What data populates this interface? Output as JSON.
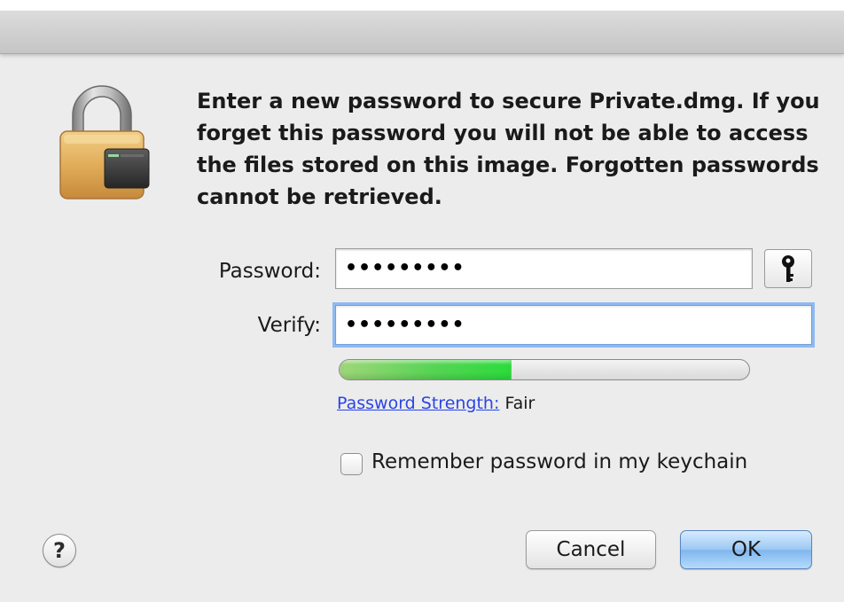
{
  "dialog": {
    "icon": "padlock-icon",
    "message": "Enter a new password to secure Private.dmg.  If you forget this password you will not be able to access the files stored on this image. Forgotten passwords cannot be retrieved."
  },
  "form": {
    "password_label": "Password:",
    "password_value": "•••••••••",
    "verify_label": "Verify:",
    "verify_value": "•••••••••",
    "key_button_icon": "key-icon"
  },
  "strength": {
    "fill_fraction": 0.42,
    "link_label": "Password Strength:",
    "value": "Fair",
    "colors": {
      "fill_start": "#9fd67a",
      "fill_end": "#2bdc3c"
    }
  },
  "keychain": {
    "label": "Remember password in my keychain",
    "checked": false
  },
  "buttons": {
    "help_label": "?",
    "cancel_label": "Cancel",
    "ok_label": "OK"
  },
  "colors": {
    "link": "#2a45e6",
    "focus_ring": "#8fbaf0",
    "default_button": "#7fb6ee"
  }
}
